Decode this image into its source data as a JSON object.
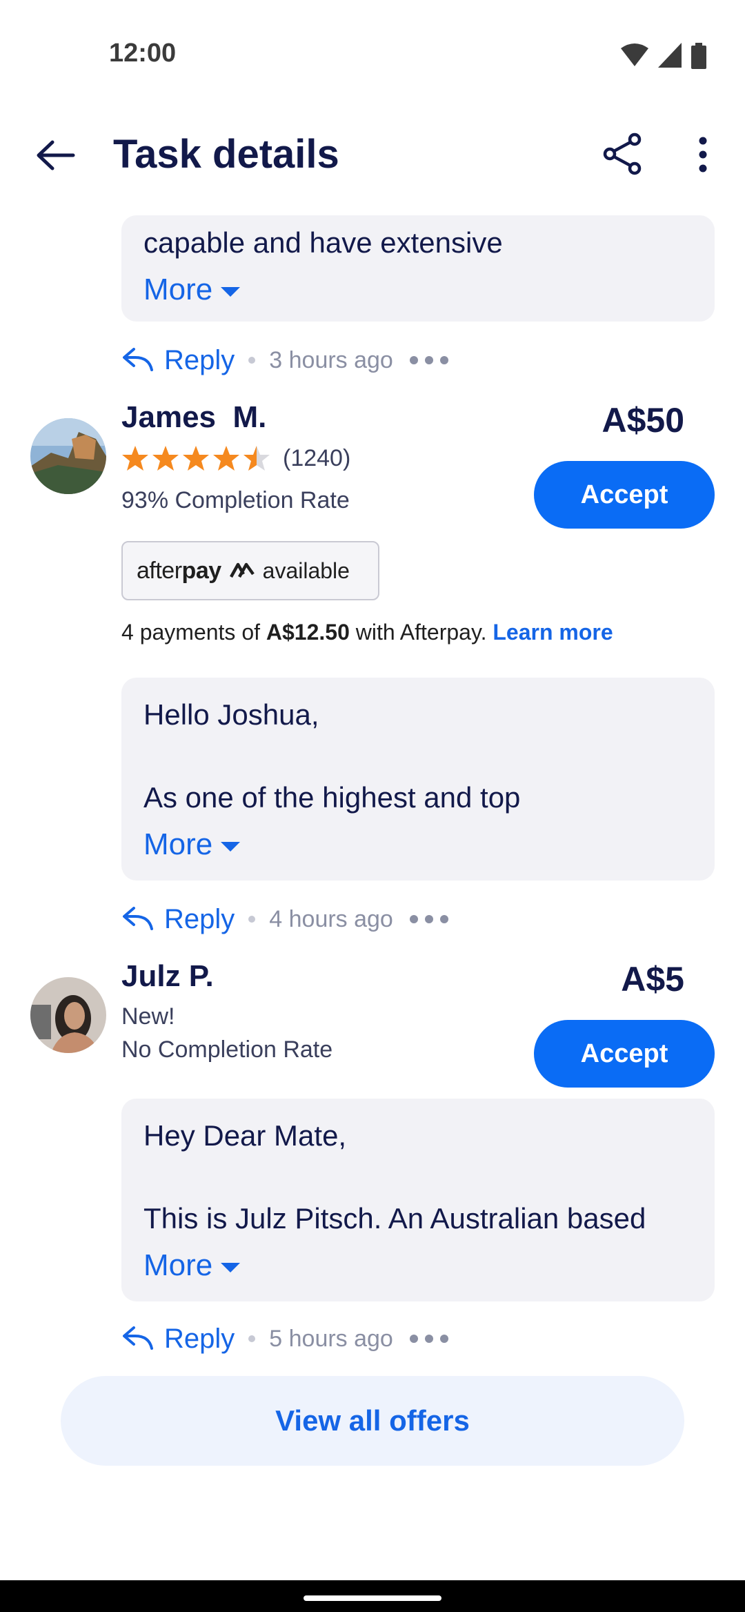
{
  "status_bar": {
    "time": "12:00"
  },
  "header": {
    "title": "Task details"
  },
  "offers": [
    {
      "message": {
        "lines": [
          "capable and have extensive"
        ],
        "more_label": "More"
      },
      "reply": {
        "label": "Reply",
        "time_ago": "3 hours ago"
      }
    },
    {
      "name": "James  M.",
      "price": "A$50",
      "rating": 4.5,
      "rating_count": "(1240)",
      "completion": "93% Completion Rate",
      "accept_label": "Accept",
      "afterpay": {
        "logo_plain": "after",
        "logo_bold": "pay",
        "available": "available",
        "text_prefix": "4 payments of ",
        "amount": "A$12.50",
        "text_suffix": " with Afterpay. ",
        "learn_more": "Learn more"
      },
      "message": {
        "lines": [
          "Hello Joshua,",
          "",
          "As one of the highest and top"
        ],
        "more_label": "More"
      },
      "reply": {
        "label": "Reply",
        "time_ago": "4 hours ago"
      }
    },
    {
      "name": "Julz P.",
      "price": "A$5",
      "status": "New!",
      "completion": "No Completion Rate",
      "accept_label": "Accept",
      "message": {
        "lines": [
          "Hey Dear Mate,",
          "",
          "This is Julz Pitsch. An Australian based"
        ],
        "more_label": "More"
      },
      "reply": {
        "label": "Reply",
        "time_ago": "5 hours ago"
      }
    }
  ],
  "view_all_label": "View all offers",
  "colors": {
    "accent": "#0a6cf5",
    "link": "#1565e6",
    "star": "#f5891f",
    "text": "#12194a"
  }
}
